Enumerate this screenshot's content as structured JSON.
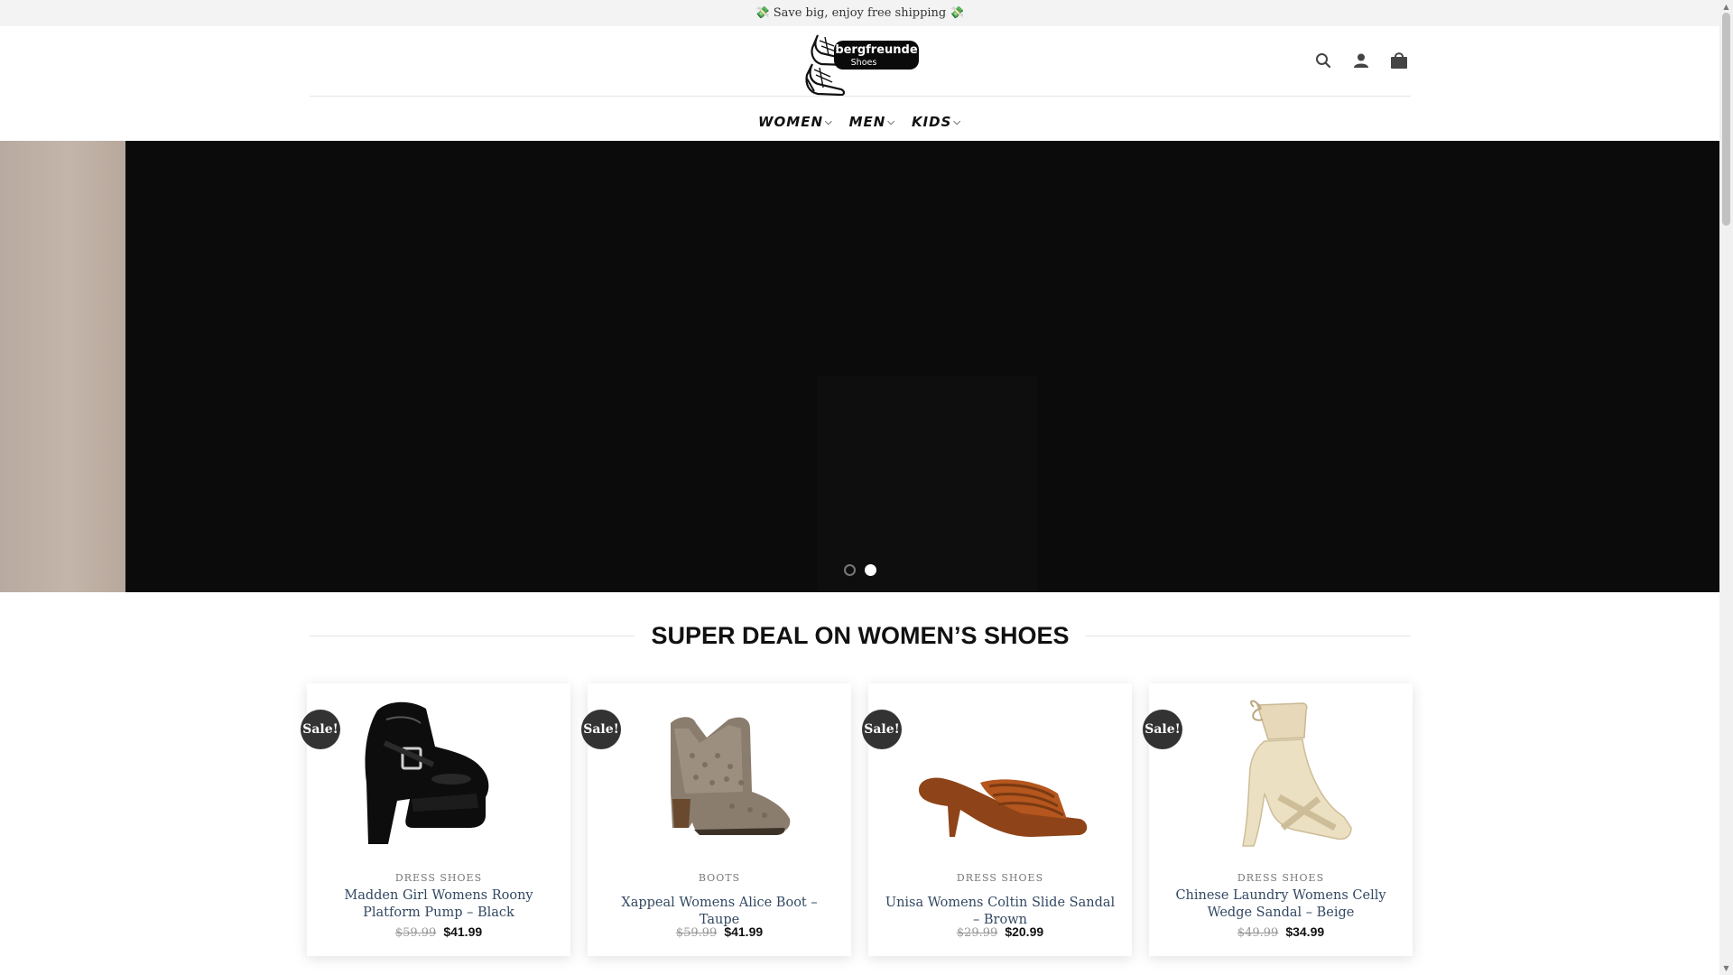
{
  "announcement": {
    "icon_left": "💸",
    "text": "Save big, enjoy free shipping",
    "icon_right": "💸"
  },
  "header": {
    "logo": {
      "brand": "bergfreunde",
      "sub": "Shoes"
    },
    "icons": [
      "search-icon",
      "user-icon",
      "cart-icon"
    ]
  },
  "nav": {
    "items": [
      {
        "label": "WOMEN"
      },
      {
        "label": "MEN"
      },
      {
        "label": "KIDS"
      }
    ]
  },
  "hero": {
    "slides_total": 2,
    "active_slide": 2
  },
  "section": {
    "title": "SUPER DEAL ON WOMEN’S SHOES"
  },
  "products": [
    {
      "badge": "Sale!",
      "category": "DRESS SHOES",
      "name": "Madden Girl Womens Roony Platform Pump – Black",
      "old_price": "$59.99",
      "price": "$41.99"
    },
    {
      "badge": "Sale!",
      "category": "BOOTS",
      "name": "Xappeal Womens Alice Boot – Taupe",
      "old_price": "$59.99",
      "price": "$41.99"
    },
    {
      "badge": "Sale!",
      "category": "DRESS SHOES",
      "name": "Unisa Womens Coltin Slide Sandal – Brown",
      "old_price": "$29.99",
      "price": "$20.99"
    },
    {
      "badge": "Sale!",
      "category": "DRESS SHOES",
      "name": "Chinese Laundry Womens Celly Wedge Sandal – Beige",
      "old_price": "$49.99",
      "price": "$34.99"
    }
  ]
}
